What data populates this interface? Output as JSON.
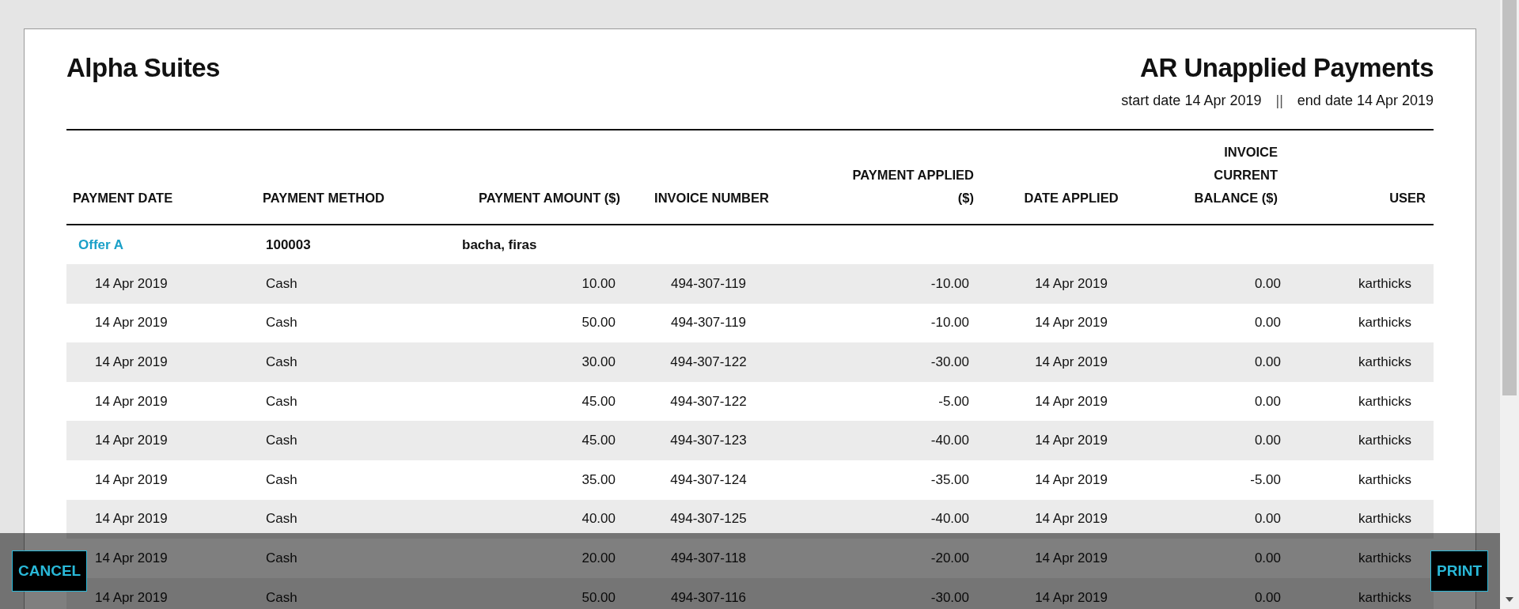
{
  "report": {
    "company": "Alpha Suites",
    "title": "AR Unapplied Payments",
    "start_date": "start date 14 Apr 2019",
    "separator": "||",
    "end_date": "end date 14 Apr 2019"
  },
  "table": {
    "columns": [
      {
        "label": "PAYMENT DATE"
      },
      {
        "label": "PAYMENT METHOD"
      },
      {
        "label": "PAYMENT AMOUNT ($)"
      },
      {
        "label": "INVOICE NUMBER"
      },
      {
        "label": "PAYMENT APPLIED ($)"
      },
      {
        "label": "DATE APPLIED"
      },
      {
        "label": "INVOICE CURRENT BALANCE ($)"
      },
      {
        "label": "USER"
      }
    ],
    "group": {
      "title": "Offer A",
      "code": "100003",
      "name": "bacha, firas"
    },
    "rows": [
      [
        "14 Apr 2019",
        "Cash",
        "10.00",
        "494-307-119",
        "-10.00",
        "14 Apr 2019",
        "0.00",
        "karthicks"
      ],
      [
        "14 Apr 2019",
        "Cash",
        "50.00",
        "494-307-119",
        "-10.00",
        "14 Apr 2019",
        "0.00",
        "karthicks"
      ],
      [
        "14 Apr 2019",
        "Cash",
        "30.00",
        "494-307-122",
        "-30.00",
        "14 Apr 2019",
        "0.00",
        "karthicks"
      ],
      [
        "14 Apr 2019",
        "Cash",
        "45.00",
        "494-307-122",
        "-5.00",
        "14 Apr 2019",
        "0.00",
        "karthicks"
      ],
      [
        "14 Apr 2019",
        "Cash",
        "45.00",
        "494-307-123",
        "-40.00",
        "14 Apr 2019",
        "0.00",
        "karthicks"
      ],
      [
        "14 Apr 2019",
        "Cash",
        "35.00",
        "494-307-124",
        "-35.00",
        "14 Apr 2019",
        "-5.00",
        "karthicks"
      ],
      [
        "14 Apr 2019",
        "Cash",
        "40.00",
        "494-307-125",
        "-40.00",
        "14 Apr 2019",
        "0.00",
        "karthicks"
      ],
      [
        "14 Apr 2019",
        "Cash",
        "20.00",
        "494-307-118",
        "-20.00",
        "14 Apr 2019",
        "0.00",
        "karthicks"
      ],
      [
        "14 Apr 2019",
        "Cash",
        "50.00",
        "494-307-116",
        "-30.00",
        "14 Apr 2019",
        "0.00",
        "karthicks"
      ]
    ]
  },
  "actions": {
    "cancel": "CANCEL",
    "print": "PRINT"
  }
}
